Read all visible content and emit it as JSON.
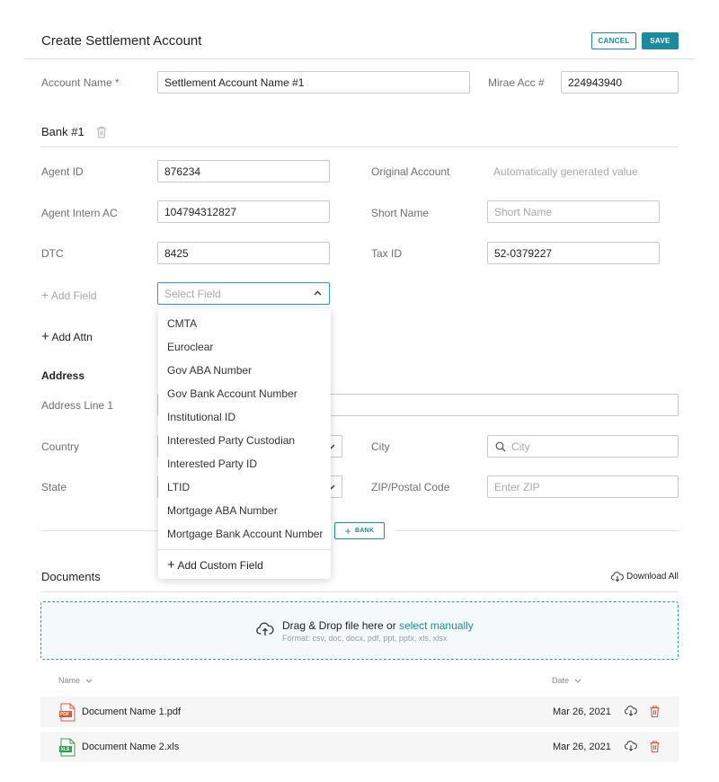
{
  "header": {
    "title": "Create Settlement Account",
    "cancel_label": "CANCEL",
    "save_label": "SAVE"
  },
  "account": {
    "name_label": "Account Name",
    "required_mark": "*",
    "name_value": "Settlement Account Name #1",
    "mirae_label": "Mirae Acc #",
    "mirae_value": "224943940"
  },
  "bank": {
    "heading": "Bank #1",
    "agent_id_label": "Agent ID",
    "agent_id_value": "876234",
    "original_account_label": "Original Account",
    "original_account_value": "Automatically generated value",
    "agent_intern_label": "Agent Intern AC",
    "agent_intern_value": "104794312827",
    "short_name_label": "Short Name",
    "short_name_placeholder": "Short Name",
    "dtc_label": "DTC",
    "dtc_value": "8425",
    "tax_id_label": "Tax ID",
    "tax_id_value": "52-0379227",
    "add_field_label": "Add Field",
    "select_field_placeholder": "Select Field",
    "add_attn_label": "Add Attn",
    "add_bank_label": "BANK"
  },
  "field_options": [
    "CMTA",
    "Euroclear",
    "Gov ABA Number",
    "Gov Bank Account Number",
    "Institutional ID",
    "Interested Party Custodian",
    "Interested Party ID",
    "LTID",
    "Mortgage ABA Number",
    "Mortgage Bank Account Number"
  ],
  "add_custom_field_label": "Add Custom Field",
  "address": {
    "heading": "Address",
    "line1_label": "Address Line 1",
    "country_label": "Country",
    "city_label": "City",
    "city_placeholder": "City",
    "state_label": "State",
    "zip_label": "ZIP/Postal Code",
    "zip_placeholder": "Enter ZIP"
  },
  "documents": {
    "heading": "Documents",
    "download_all_label": "Download All",
    "drop_text": "Drag & Drop file here or",
    "select_link": "select manually",
    "formats": "Format: csv, doc, docx, pdf, ppt, pptx, xls, xlsx",
    "col_name": "Name",
    "col_date": "Date",
    "files": [
      {
        "name": "Document Name 1.pdf",
        "date": "Mar 26, 2021",
        "type": "PDF",
        "color": "#e5533d"
      },
      {
        "name": "Document Name 2.xls",
        "date": "Mar 26, 2021",
        "type": "XLS",
        "color": "#2e9e4f"
      }
    ]
  },
  "colors": {
    "accent": "#1a8a9c",
    "danger": "#e5533d"
  }
}
